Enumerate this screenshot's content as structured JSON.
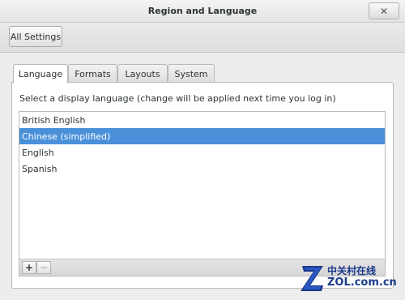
{
  "window": {
    "title": "Region and Language",
    "close_icon": "close-icon"
  },
  "toolbar": {
    "all_settings_label": "All Settings"
  },
  "tabs": [
    {
      "label": "Language",
      "active": true
    },
    {
      "label": "Formats",
      "active": false
    },
    {
      "label": "Layouts",
      "active": false
    },
    {
      "label": "System",
      "active": false
    }
  ],
  "language_panel": {
    "hint": "Select a display language (change will be applied next time you log in)",
    "languages": [
      {
        "label": "British English",
        "selected": false
      },
      {
        "label": "Chinese (simplified)",
        "selected": true
      },
      {
        "label": "English",
        "selected": false
      },
      {
        "label": "Spanish",
        "selected": false
      }
    ],
    "add_label": "+",
    "remove_label": "−"
  },
  "colors": {
    "selection": "#4a90d9",
    "watermark": "#1a3a8a"
  },
  "watermark": {
    "chinese": "中关村在线",
    "url": "ZOL.com.cn"
  }
}
